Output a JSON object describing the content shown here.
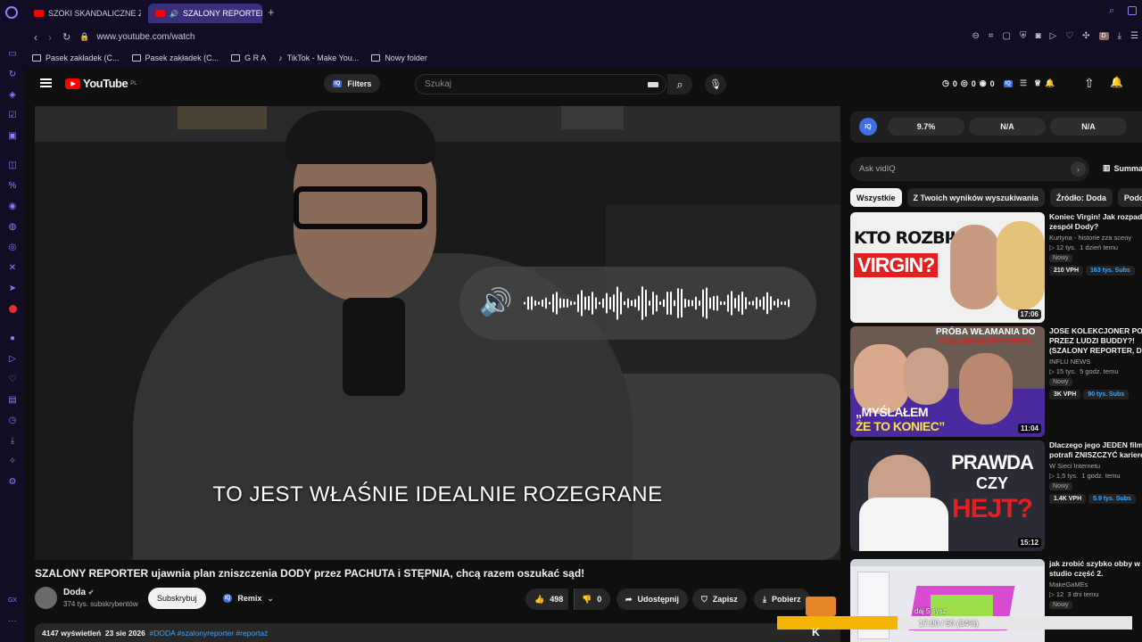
{
  "browser": {
    "tabs": [
      {
        "label": "SZOKI SKANDALICZNE ZA..."
      },
      {
        "label": "SZALONY REPORTER ujawnia..."
      }
    ],
    "url": "www.youtube.com/watch",
    "bookmarks": [
      {
        "label": "Pasek zakładek (C..."
      },
      {
        "label": "Pasek zakładek (C..."
      },
      {
        "label": "G R A"
      },
      {
        "label": "TikTok - Make You..."
      },
      {
        "label": "Nowy folder"
      }
    ]
  },
  "header": {
    "logo": "YouTube",
    "logo_country": "PL",
    "filters": "Filters",
    "search_placeholder": "Szukaj",
    "counters": [
      "0",
      "0",
      "0",
      "0"
    ]
  },
  "video": {
    "caption": "TO JEST WŁAŚNIE IDEALNIE ROZEGRANE",
    "title": "SZALONY REPORTER ujawnia plan zniszczenia DODY przez PACHUTA i STĘPNIA, chcą razem oszukać sąd!",
    "channel": "Doda",
    "subscribers": "374 tys. subskrybentów",
    "subscribe": "Subskrybuj",
    "remix": "Remix",
    "likes": "498",
    "dislikes": "0",
    "share": "Udostępnij",
    "save": "Zapisz",
    "download": "Pobierz",
    "views": "4147 wyświetleń",
    "date": "23 sie 2026",
    "hashtags": "#DODA #szalonyreporter #reportaż"
  },
  "vidiq": {
    "label": "IQ",
    "stats": [
      "9.7%",
      "N/A",
      "N/A"
    ],
    "ask_placeholder": "Ask vidIQ",
    "summary": "Summa"
  },
  "chips": [
    "Wszystkie",
    "Z Twoich wyników wyszukiwania",
    "Źródło: Doda",
    "Podobn"
  ],
  "recommendations": [
    {
      "title1": "Koniec Virgin! Jak rozpadł",
      "title2": "zespół Dody?",
      "channel": "Kurtyna - historie zza sceny",
      "views": "12 tys.",
      "age": "1 dzień temu",
      "badge": "Nowy",
      "vph": "210 VPH",
      "subs": "163 tys. Subs",
      "duration": "17:06",
      "thumb_line1": "KTO ROZBIŁ",
      "thumb_line2": "VIRGIN?"
    },
    {
      "title1": "JOSE KOLEKCJONER POBI",
      "title2": "PRZEZ LUDZI BUDDY?!",
      "title3": "(SZALONY REPORTER, DIO",
      "channel": "INFLU NEWS",
      "views": "15 tys.",
      "age": "5 godz. temu",
      "badge": "Nowy",
      "vph": "3K VPH",
      "subs": "90 tys. Subs",
      "duration": "11:04",
      "thumb_line1": "PRÓBA WŁAMANIA DO",
      "thumb_line2": "SZALONEGO REPORTERA!",
      "thumb_line3": "„MYŚLAŁEM",
      "thumb_line4": "ŻE TO KONIEC”"
    },
    {
      "title1": "Dlaczego jego JEDEN film",
      "title2": "potrafi ZNISZCZYĆ karierę",
      "channel": "W Sieci Internetu",
      "views": "1,5 tys.",
      "age": "1 godz. temu",
      "badge": "Nowy",
      "vph": "1.4K VPH",
      "subs": "5.9 tys. Subs",
      "duration": "15:12",
      "thumb_line1": "PRAWDA",
      "thumb_line2": "CZY",
      "thumb_line3": "HEJT?"
    },
    {
      "title1": "jak zrobić szybko obby w r",
      "title2": "studio część 2.",
      "channel": "MakeGaMEs",
      "views": "12",
      "age": "3 dni temu",
      "badge": "Nowy"
    }
  ],
  "overlay": {
    "line1": "daj 5 sysz",
    "line2": "17.00 / 50 (34%)"
  },
  "colors": {
    "youtube_red": "#ff0000",
    "vidiq_blue": "#3f6fe0",
    "browser_bg": "#120d24",
    "accent": "#8f7cff",
    "progress": "#f5b400"
  }
}
